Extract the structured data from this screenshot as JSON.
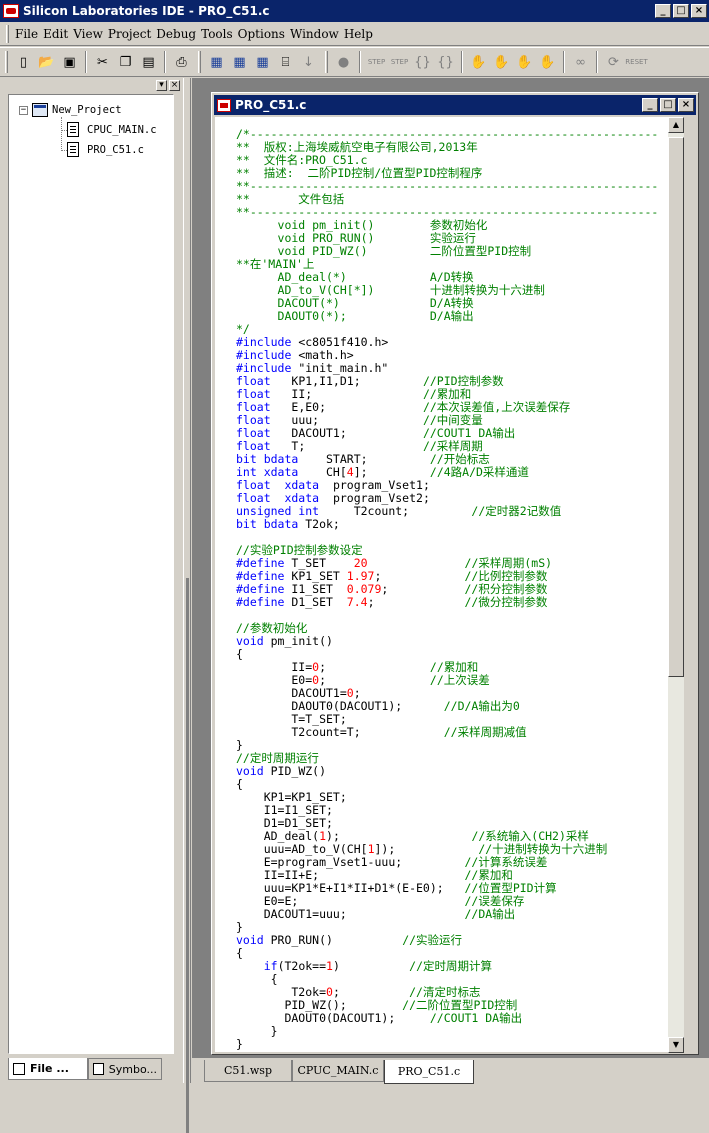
{
  "app": {
    "title": "Silicon Laboratories IDE - PRO_C51.c",
    "window_buttons": [
      "_",
      "□",
      "×"
    ]
  },
  "menu": [
    "File",
    "Edit",
    "View",
    "Project",
    "Debug",
    "Tools",
    "Options",
    "Window",
    "Help"
  ],
  "toolbar": {
    "groups": [
      [
        "new-file-icon",
        "open-folder-icon",
        "save-icon"
      ],
      [
        "cut-icon",
        "copy-icon",
        "paste-icon"
      ],
      [
        "print-icon"
      ],
      [
        "build-icon",
        "rebuild-icon",
        "build-all-icon",
        "download-icon",
        "download-arrow-icon"
      ],
      [
        "stop-icon"
      ],
      [
        "step-icon",
        "step-over-icon",
        "step-out-icon",
        "run-to-cursor-icon"
      ],
      [
        "hand-icon",
        "hand-stop-icon",
        "hand-multi-icon",
        "hand-all-icon"
      ],
      [
        "watch-icon"
      ],
      [
        "refresh-icon",
        "reset-icon"
      ]
    ],
    "reset_label": "RESET",
    "step_label": "STEP"
  },
  "project_tree": {
    "root": "New_Project",
    "files": [
      "CPUC_MAIN.c",
      "PRO_C51.c"
    ]
  },
  "left_tabs": [
    {
      "label": "File ...",
      "active": true
    },
    {
      "label": "Symbo...",
      "active": false
    }
  ],
  "editor": {
    "title": "PRO_C51.c",
    "lines": [
      [
        [
          "cm",
          "/*-----------------------------------------------------------"
        ]
      ],
      [
        [
          "cm",
          "**  版权:上海埃威航空电子有限公司,2013年"
        ]
      ],
      [
        [
          "cm",
          "**  文件名:PRO_C51.c"
        ]
      ],
      [
        [
          "cm",
          "**  描述:  二阶PID控制/位置型PID控制程序"
        ]
      ],
      [
        [
          "cm",
          "**-----------------------------------------------------------"
        ]
      ],
      [
        [
          "cm",
          "**       文件包括"
        ]
      ],
      [
        [
          "cm",
          "**-----------------------------------------------------------"
        ]
      ],
      [
        [
          "cm",
          "      void pm_init()        参数初始化"
        ]
      ],
      [
        [
          "cm",
          "      void PRO_RUN()        实验运行"
        ]
      ],
      [
        [
          "cm",
          "      void PID_WZ()         二阶位置型PID控制"
        ]
      ],
      [
        [
          "cm",
          "**在'MAIN'上"
        ]
      ],
      [
        [
          "cm",
          "      AD_deal(*)            A/D转换"
        ]
      ],
      [
        [
          "cm",
          "      AD_to_V(CH[*])        十进制转换为十六进制"
        ]
      ],
      [
        [
          "cm",
          "      DACOUT(*)             D/A转换"
        ]
      ],
      [
        [
          "cm",
          "      DAOUT0(*);            D/A输出"
        ]
      ],
      [
        [
          "cm",
          "*/"
        ]
      ],
      [
        [
          "kw",
          "#include"
        ],
        [
          "tx",
          " <c8051f410.h>"
        ]
      ],
      [
        [
          "kw",
          "#include"
        ],
        [
          "tx",
          " <math.h>"
        ]
      ],
      [
        [
          "kw",
          "#include"
        ],
        [
          "tx",
          " \"init_main.h\""
        ]
      ],
      [
        [
          "kw",
          "float"
        ],
        [
          "tx",
          "   KP1,I1,D1;         "
        ],
        [
          "cm",
          "//PID控制参数"
        ]
      ],
      [
        [
          "kw",
          "float"
        ],
        [
          "tx",
          "   II;                "
        ],
        [
          "cm",
          "//累加和"
        ]
      ],
      [
        [
          "kw",
          "float"
        ],
        [
          "tx",
          "   E,E0;              "
        ],
        [
          "cm",
          "//本次误差值,上次误差保存"
        ]
      ],
      [
        [
          "kw",
          "float"
        ],
        [
          "tx",
          "   uuu;               "
        ],
        [
          "cm",
          "//中间变量"
        ]
      ],
      [
        [
          "kw",
          "float"
        ],
        [
          "tx",
          "   DACOUT1;           "
        ],
        [
          "cm",
          "//COUT1 DA输出"
        ]
      ],
      [
        [
          "kw",
          "float"
        ],
        [
          "tx",
          "   T;                 "
        ],
        [
          "cm",
          "//采样周期"
        ]
      ],
      [
        [
          "kw",
          "bit bdata"
        ],
        [
          "tx",
          "    START;         "
        ],
        [
          "cm",
          "//开始标志"
        ]
      ],
      [
        [
          "kw",
          "int xdata"
        ],
        [
          "tx",
          "    CH["
        ],
        [
          "num",
          "4"
        ],
        [
          "tx",
          "];         "
        ],
        [
          "cm",
          "//4路A/D采样通道"
        ]
      ],
      [
        [
          "kw",
          "float  xdata"
        ],
        [
          "tx",
          "  program_Vset1;"
        ]
      ],
      [
        [
          "kw",
          "float  xdata"
        ],
        [
          "tx",
          "  program_Vset2;"
        ]
      ],
      [
        [
          "kw",
          "unsigned int"
        ],
        [
          "tx",
          "     T2count;         "
        ],
        [
          "cm",
          "//定时器2记数值"
        ]
      ],
      [
        [
          "kw",
          "bit bdata"
        ],
        [
          "tx",
          " T2ok;"
        ]
      ],
      [
        [
          "tx",
          ""
        ]
      ],
      [
        [
          "cm",
          "//实验PID控制参数设定"
        ]
      ],
      [
        [
          "kw",
          "#define"
        ],
        [
          "tx",
          " T_SET    "
        ],
        [
          "num",
          "20"
        ],
        [
          "tx",
          "              "
        ],
        [
          "cm",
          "//采样周期(mS)"
        ]
      ],
      [
        [
          "kw",
          "#define"
        ],
        [
          "tx",
          " KP1_SET "
        ],
        [
          "num",
          "1.97"
        ],
        [
          "tx",
          ";            "
        ],
        [
          "cm",
          "//比例控制参数"
        ]
      ],
      [
        [
          "kw",
          "#define"
        ],
        [
          "tx",
          " I1_SET  "
        ],
        [
          "num",
          "0.079"
        ],
        [
          "tx",
          ";           "
        ],
        [
          "cm",
          "//积分控制参数"
        ]
      ],
      [
        [
          "kw",
          "#define"
        ],
        [
          "tx",
          " D1_SET  "
        ],
        [
          "num",
          "7.4"
        ],
        [
          "tx",
          ";             "
        ],
        [
          "cm",
          "//微分控制参数"
        ]
      ],
      [
        [
          "tx",
          ""
        ]
      ],
      [
        [
          "cm",
          "//参数初始化"
        ]
      ],
      [
        [
          "kw",
          "void"
        ],
        [
          "tx",
          " pm_init()"
        ]
      ],
      [
        [
          "tx",
          "{"
        ]
      ],
      [
        [
          "tx",
          "        II="
        ],
        [
          "num",
          "0"
        ],
        [
          "tx",
          ";               "
        ],
        [
          "cm",
          "//累加和"
        ]
      ],
      [
        [
          "tx",
          "        E0="
        ],
        [
          "num",
          "0"
        ],
        [
          "tx",
          ";               "
        ],
        [
          "cm",
          "//上次误差"
        ]
      ],
      [
        [
          "tx",
          "        DACOUT1="
        ],
        [
          "num",
          "0"
        ],
        [
          "tx",
          ";"
        ]
      ],
      [
        [
          "tx",
          "        DAOUT0(DACOUT1);      "
        ],
        [
          "cm",
          "//D/A输出为0"
        ]
      ],
      [
        [
          "tx",
          "        T=T_SET;"
        ]
      ],
      [
        [
          "tx",
          "        T2count=T;            "
        ],
        [
          "cm",
          "//采样周期减值"
        ]
      ],
      [
        [
          "tx",
          "}"
        ]
      ],
      [
        [
          "cm",
          "//定时周期运行"
        ]
      ],
      [
        [
          "kw",
          "void"
        ],
        [
          "tx",
          " PID_WZ()"
        ]
      ],
      [
        [
          "tx",
          "{"
        ]
      ],
      [
        [
          "tx",
          "    KP1=KP1_SET;"
        ]
      ],
      [
        [
          "tx",
          "    I1=I1_SET;"
        ]
      ],
      [
        [
          "tx",
          "    D1=D1_SET;"
        ]
      ],
      [
        [
          "tx",
          "    AD_deal("
        ],
        [
          "num",
          "1"
        ],
        [
          "tx",
          ");                   "
        ],
        [
          "cm",
          "//系统输入(CH2)采样"
        ]
      ],
      [
        [
          "tx",
          "    uuu=AD_to_V(CH["
        ],
        [
          "num",
          "1"
        ],
        [
          "tx",
          "]);            "
        ],
        [
          "cm",
          "//十进制转换为十六进制"
        ]
      ],
      [
        [
          "tx",
          "    E=program_Vset1-uuu;         "
        ],
        [
          "cm",
          "//计算系统误差"
        ]
      ],
      [
        [
          "tx",
          "    II=II+E;                     "
        ],
        [
          "cm",
          "//累加和"
        ]
      ],
      [
        [
          "tx",
          "    uuu=KP1*E+I1*II+D1*(E-E0);   "
        ],
        [
          "cm",
          "//位置型PID计算"
        ]
      ],
      [
        [
          "tx",
          "    E0=E;                        "
        ],
        [
          "cm",
          "//误差保存"
        ]
      ],
      [
        [
          "tx",
          "    DACOUT1=uuu;                 "
        ],
        [
          "cm",
          "//DA输出"
        ]
      ],
      [
        [
          "tx",
          "}"
        ]
      ],
      [
        [
          "kw",
          "void"
        ],
        [
          "tx",
          " PRO_RUN()          "
        ],
        [
          "cm",
          "//实验运行"
        ]
      ],
      [
        [
          "tx",
          "{"
        ]
      ],
      [
        [
          "tx",
          "    "
        ],
        [
          "kw",
          "if"
        ],
        [
          "tx",
          "(T2ok=="
        ],
        [
          "num",
          "1"
        ],
        [
          "tx",
          ")          "
        ],
        [
          "cm",
          "//定时周期计算"
        ]
      ],
      [
        [
          "tx",
          "     {"
        ]
      ],
      [
        [
          "tx",
          "        T2ok="
        ],
        [
          "num",
          "0"
        ],
        [
          "tx",
          ";          "
        ],
        [
          "cm",
          "//清定时标志"
        ]
      ],
      [
        [
          "tx",
          "       PID_WZ();        "
        ],
        [
          "cm",
          "//二阶位置型PID控制"
        ]
      ],
      [
        [
          "tx",
          "       DAOUT0(DACOUT1);     "
        ],
        [
          "cm",
          "//COUT1 DA输出"
        ]
      ],
      [
        [
          "tx",
          "     }"
        ]
      ],
      [
        [
          "tx",
          "}"
        ]
      ]
    ]
  },
  "bottom_tabs": [
    {
      "label": "C51.wsp",
      "active": false
    },
    {
      "label": "CPUC_MAIN.c",
      "active": false
    },
    {
      "label": "PRO_C51.c",
      "active": true
    }
  ]
}
